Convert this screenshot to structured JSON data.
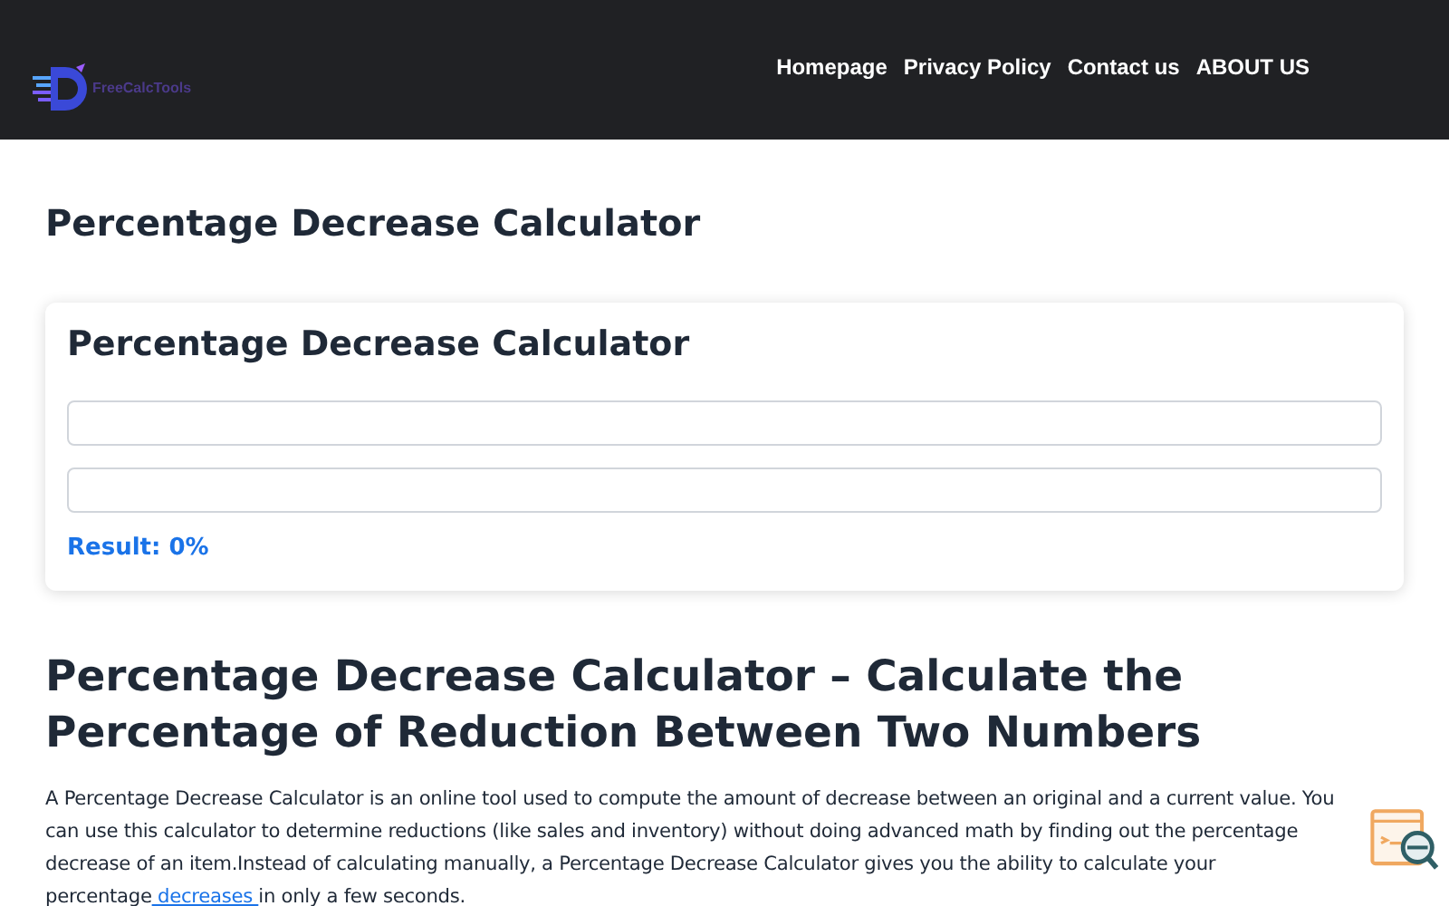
{
  "header": {
    "logo_text": "FreeCalcTools",
    "nav": [
      {
        "label": "Homepage"
      },
      {
        "label": "Privacy Policy"
      },
      {
        "label": "Contact us"
      },
      {
        "label": "ABOUT US"
      }
    ]
  },
  "page_title": "Percentage Decrease Calculator",
  "calculator": {
    "title": "Percentage Decrease Calculator",
    "inputs": [
      {
        "kind": "number"
      },
      {
        "kind": "number"
      }
    ],
    "result": "Result: 0%"
  },
  "article": {
    "heading": "Percentage Decrease Calculator – Calculate the Percentage of Reduction Between Two Numbers",
    "paragraph": {
      "before": "A Percentage Decrease Calculator is an online tool used to compute the amount of decrease between an original and a current value. You can use this calculator to determine reductions (like sales and inventory) without doing advanced math by finding out the percentage decrease of an item.Instead of calculating manually, a Percentage Decrease Calculator gives you the ability to calculate your percentage",
      "link": " decreases ",
      "after": "in only a few seconds."
    }
  }
}
